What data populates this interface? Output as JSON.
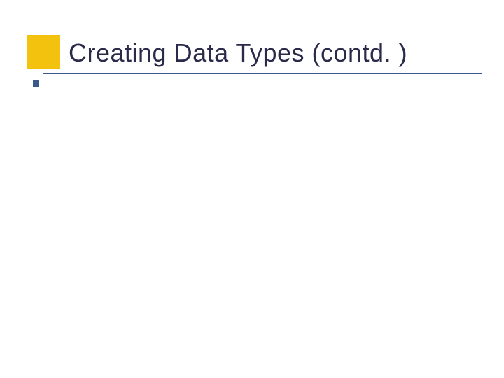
{
  "slide": {
    "title": "Creating Data Types (contd. )",
    "colors": {
      "accent_square": "#f2c20f",
      "bullet": "#3a5a8a",
      "underline": "#3a5a8a",
      "title_text": "#2a2a4a"
    }
  }
}
